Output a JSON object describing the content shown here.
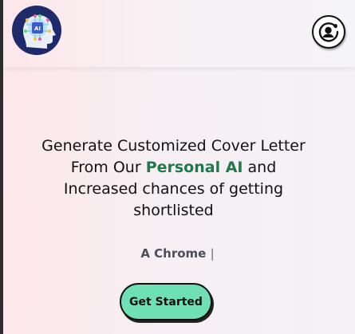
{
  "header": {
    "logo_icon": "ai-head-logo-icon",
    "profile_icon": "user-profile-icon"
  },
  "hero": {
    "headline_part1": "Generate Customized Cover Letter From Our ",
    "headline_highlight": "Personal AI",
    "headline_part2": " and Increased chances of getting shortlisted",
    "tagline": "A Chrome",
    "tagline_cursor": "|",
    "cta_label": "Get Started"
  },
  "colors": {
    "accent_green": "#1f7a4b",
    "cta_background": "#6fe0b4",
    "logo_background": "#1f2a6b"
  }
}
